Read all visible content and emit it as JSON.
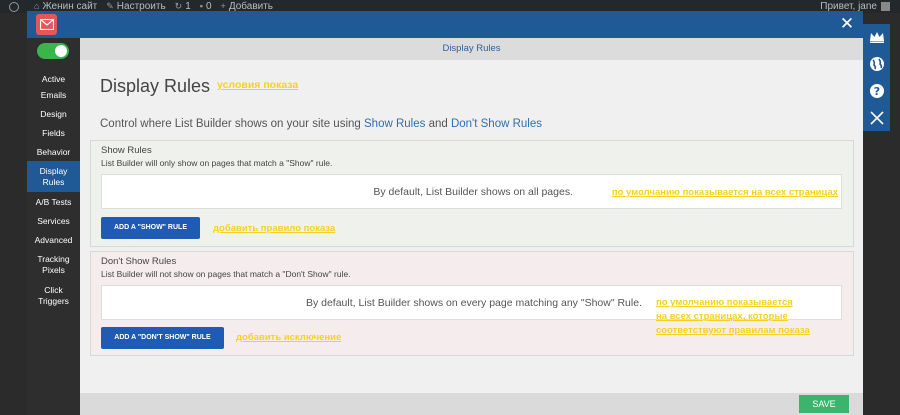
{
  "admin_bar": {
    "site_name": "Женин сайт",
    "customize": "Настроить",
    "updates_count": "1",
    "comments_count": "0",
    "add_new": "Добавить",
    "greeting": "Привет, jane"
  },
  "modal": {
    "close_label": "✕"
  },
  "sidebar": {
    "toggle_on": true,
    "items": [
      {
        "label": "Active"
      },
      {
        "label": "Emails"
      },
      {
        "label": "Design"
      },
      {
        "label": "Fields"
      },
      {
        "label": "Behavior"
      },
      {
        "label": "Display Rules",
        "line1": "Display",
        "line2": "Rules"
      },
      {
        "label": "A/B Tests"
      },
      {
        "label": "Services"
      },
      {
        "label": "Advanced"
      },
      {
        "label": "Tracking Pixels",
        "line1": "Tracking",
        "line2": "Pixels"
      },
      {
        "label": "Click Triggers",
        "line1": "Click",
        "line2": "Triggers"
      }
    ]
  },
  "header": {
    "title": "Display Rules"
  },
  "page": {
    "title": "Display Rules",
    "title_annotation": "условия показа",
    "intro_prefix": "Control where List Builder shows on your site using ",
    "intro_link1": "Show Rules",
    "intro_and": " and ",
    "intro_link2": "Don't Show Rules"
  },
  "show_rules": {
    "title": "Show Rules",
    "description": "List Builder will only show on pages that match a \"Show\" rule.",
    "default_text": "By default, List Builder shows on all pages.",
    "default_annotation": "по умолчанию показывается на всех страницах",
    "button_label": "ADD A \"SHOW\" RULE",
    "button_annotation": "добавить правило показа"
  },
  "dont_show_rules": {
    "title": "Don't Show Rules",
    "description": "List Builder will not show on pages that match a \"Don't Show\" rule.",
    "default_text": "By default, List Builder shows on every page matching any \"Show\" Rule.",
    "default_annotation_line1": "по умолчанию показывается",
    "default_annotation_line2": "на всех страницах, которые",
    "default_annotation_line3": "соответствуют правилам показа",
    "button_label": "ADD A \"DON'T SHOW\" RULE",
    "button_annotation": "добавить исключение"
  },
  "footer": {
    "save_label": "SAVE"
  },
  "colors": {
    "brand_blue": "#1f5a96",
    "button_blue": "#1f5ab4",
    "active_green": "#3bb54a",
    "save_green": "#3bb56b",
    "annotation_yellow": "#f5d21f"
  },
  "right_toolbar": {
    "icons": [
      "crown-icon",
      "globe-icon",
      "help-icon",
      "close-icon"
    ]
  }
}
